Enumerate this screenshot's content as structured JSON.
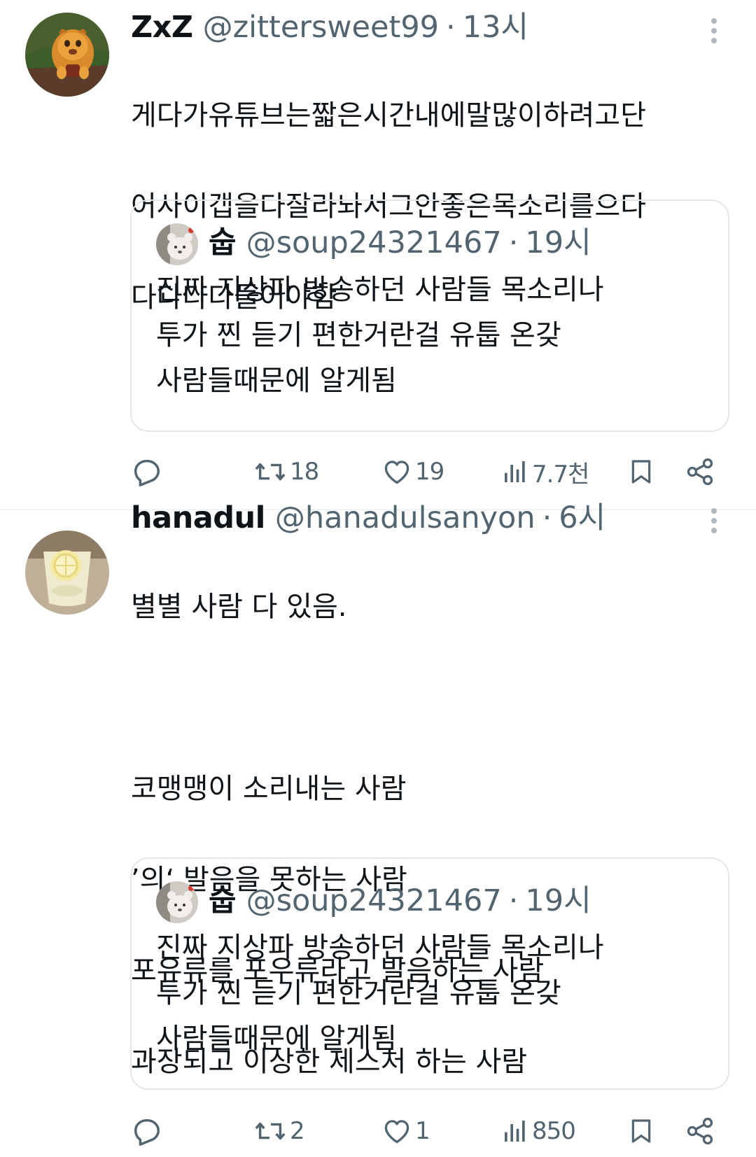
{
  "tweets": [
    {
      "display_name": "ZxZ",
      "handle": "@zittersweet99",
      "separator": "·",
      "time": "13시",
      "avatar_icon": "lion-cub-avatar",
      "lines": [
        "게다가유튜브는짧은시간내에말많이하려고단",
        "어사이갭을다잘라놔서그안좋은목소리를으다",
        "다다다다들어야함"
      ],
      "quote": {
        "display_name": "숩",
        "handle": "@soup24321467",
        "separator": "·",
        "time": "19시",
        "lines": [
          "진짜 지상파 방송하던 사람들 목소리나",
          "투가 찐 듣기 편한거란걸 유툽 온갖",
          "사람들때문에 알게됨"
        ]
      },
      "stats": {
        "reply": "",
        "retweet": "18",
        "like": "19",
        "views": "7.7천"
      }
    },
    {
      "display_name": "hanadul",
      "handle": "@hanadulsanyon",
      "separator": "·",
      "time": "6시",
      "avatar_icon": "lemon-drink-avatar",
      "lines": [
        "별별 사람 다 있음.",
        "",
        "코맹맹이 소리내는 사람",
        "’의‘ 발음을 못하는 사람",
        "포유류를 포우류라고 발음하는 사람",
        "과장되고 이상한 제스처 하는 사람"
      ],
      "quote": {
        "display_name": "숩",
        "handle": "@soup24321467",
        "separator": "·",
        "time": "19시",
        "lines": [
          "진짜 지상파 방송하던 사람들 목소리나",
          "투가 찐 듣기 편한거란걸 유툽 온갖",
          "사람들때문에 알게됨"
        ]
      },
      "stats": {
        "reply": "",
        "retweet": "2",
        "like": "1",
        "views": "850"
      }
    }
  ],
  "colors": {
    "text": "#0f1419",
    "secondary": "#536471",
    "border": "#e3e7ea",
    "divider": "#eff3f4"
  }
}
